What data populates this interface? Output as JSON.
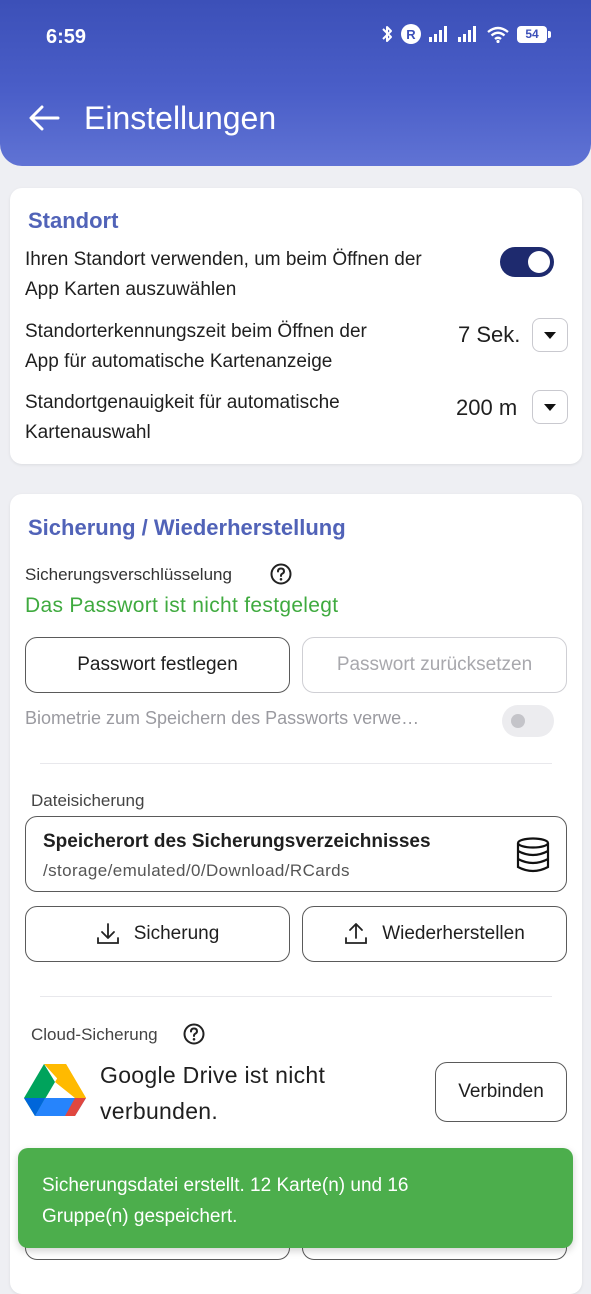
{
  "status_bar": {
    "time": "6:59",
    "roaming_badge": "R",
    "battery": "54"
  },
  "header": {
    "title": "Einstellungen"
  },
  "location": {
    "title": "Standort",
    "use_location_line1": "Ihren Standort verwenden, um beim Öffnen der",
    "use_location_line2": "App Karten auszuwählen",
    "use_location_enabled": true,
    "detect_time_line1": "Standorterkennungszeit beim Öffnen der",
    "detect_time_line2": "App für automatische Kartenanzeige",
    "detect_time_value": "7 Sek.",
    "accuracy_line1": "Standortgenauigkeit für automatische",
    "accuracy_line2": "Kartenauswahl",
    "accuracy_value": "200 m"
  },
  "backup": {
    "title": "Sicherung / Wiederherstellung",
    "encryption_label": "Sicherungsverschlüsselung",
    "password_status": "Das Passwort ist nicht festgelegt",
    "set_password_label": "Passwort festlegen",
    "reset_password_label": "Passwort zurücksetzen",
    "biometric_label": "Biometrie zum Speichern des Passworts verwe…",
    "biometric_enabled": false,
    "file_backup_label": "Dateisicherung",
    "storage_title": "Speicherort des Sicherungsverzeichnisses",
    "storage_path": "/storage/emulated/0/Download/RCards",
    "backup_button_label": "Sicherung",
    "restore_button_label": "Wiederherstellen",
    "cloud_label": "Cloud-Sicherung",
    "gdrive_line1": "Google Drive ist nicht",
    "gdrive_line2": "verbunden.",
    "connect_label": "Verbinden"
  },
  "snackbar": {
    "line1": "Sicherungsdatei erstellt. 12 Karte(n) und 16",
    "line2": "Gruppe(n) gespeichert."
  },
  "colors": {
    "header_blue": "#3c50b8",
    "section_title": "#5163b8",
    "toggle_on": "#1e2a6e",
    "success_green": "#3faa3f",
    "snackbar_green": "#4cae4c"
  }
}
